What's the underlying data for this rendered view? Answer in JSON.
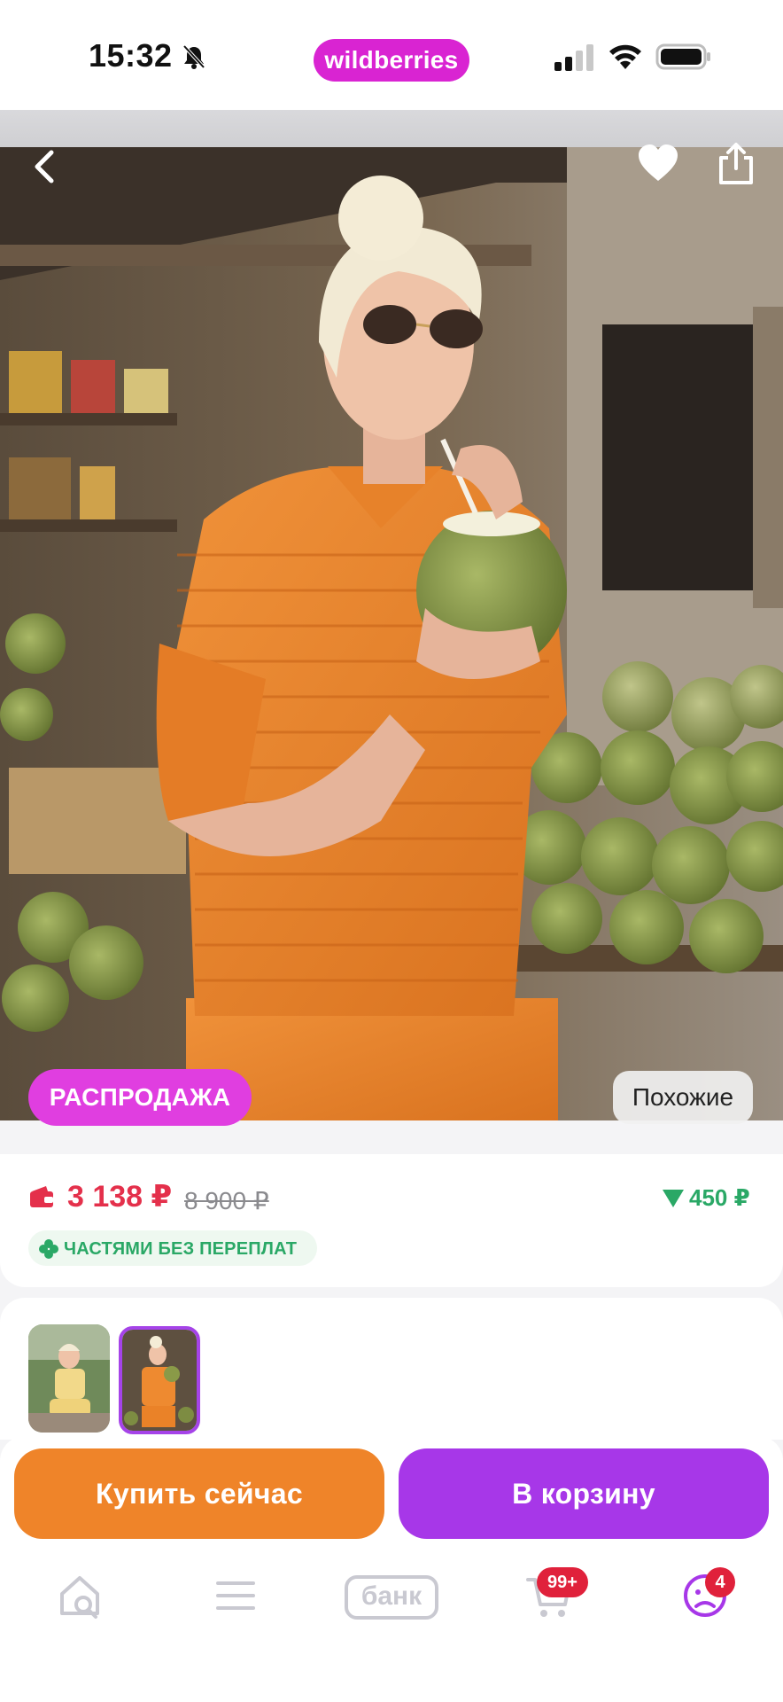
{
  "status_bar": {
    "time": "15:32",
    "brand": "wildberries",
    "icons": [
      "bell-off-icon",
      "signal-icon",
      "wifi-icon",
      "battery-icon"
    ]
  },
  "product_photo": {
    "nav_icons": [
      "back-arrow-icon",
      "heart-icon",
      "share-icon"
    ],
    "sale_badge": "РАСПРОДАЖА",
    "similar_button": "Похожие"
  },
  "price": {
    "current": "3 138 ₽",
    "old": "8 900 ₽",
    "discount": "450 ₽",
    "installments_label": "ЧАСТЯМИ БЕЗ ПЕРЕПЛАТ"
  },
  "thumbnails": {
    "count": 2,
    "selected_index": 1
  },
  "actions": {
    "buy_now": "Купить сейчас",
    "add_to_cart": "В корзину"
  },
  "tab_bar": {
    "items": [
      "home-search-icon",
      "catalog-menu-icon",
      "bank-icon",
      "cart-icon",
      "profile-icon"
    ],
    "bank_label": "банк",
    "cart_badge": "99+",
    "profile_badge": "4"
  },
  "colors": {
    "brand": "#d924d2",
    "price_red": "#e4304b",
    "discount_green": "#2aa866",
    "buy_orange": "#ef8429",
    "cart_purple": "#a737e8",
    "badge_red": "#e0213b"
  }
}
